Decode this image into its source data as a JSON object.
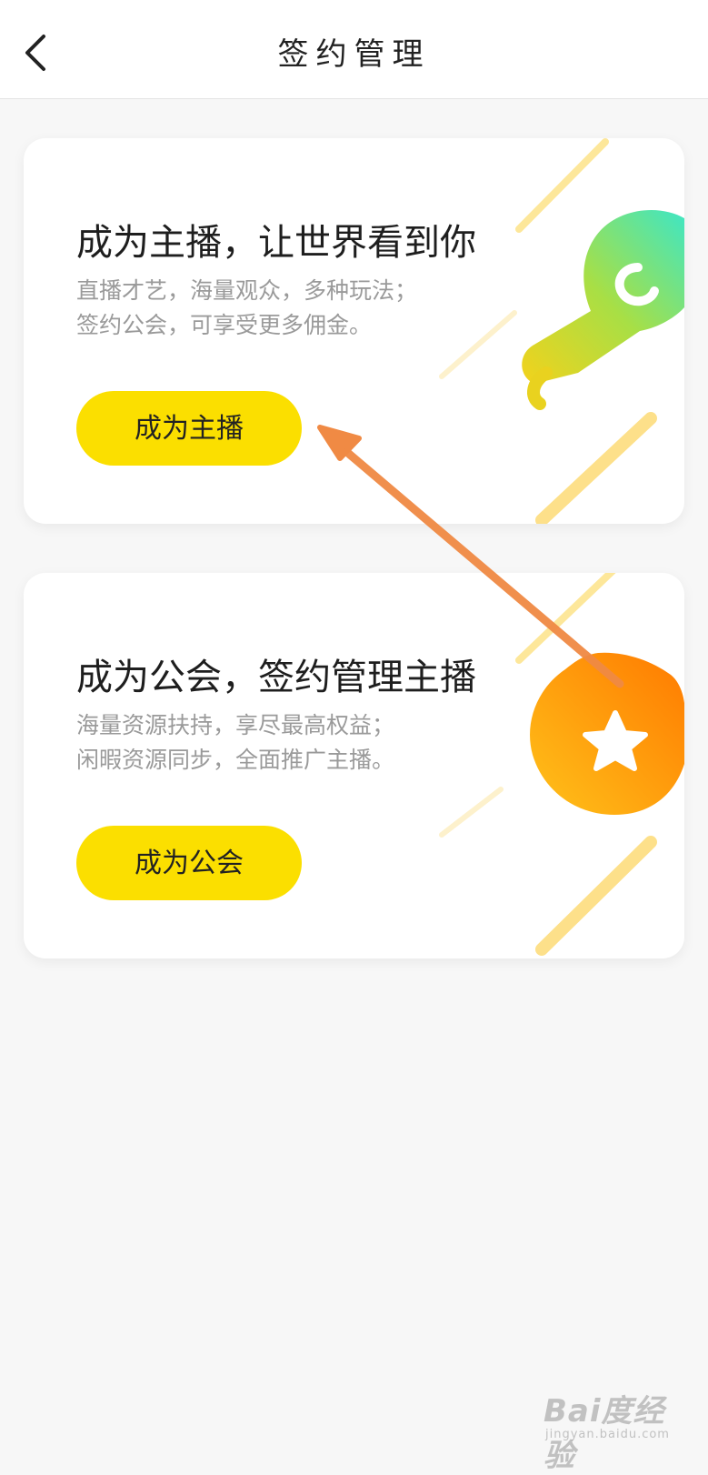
{
  "header": {
    "title": "签约管理"
  },
  "cards": [
    {
      "headline": "成为主播，让世界看到你",
      "desc_line1": "直播才艺，海量观众，多种玩法；",
      "desc_line2": "签约公会，可享受更多佣金。",
      "button_label": "成为主播",
      "icon": "microphone-icon"
    },
    {
      "headline": "成为公会，签约管理主播",
      "desc_line1": "海量资源扶持，享尽最高权益；",
      "desc_line2": "闲暇资源同步，全面推广主播。",
      "button_label": "成为公会",
      "icon": "star-badge-icon"
    }
  ],
  "watermark": {
    "logo": "Bai度经验",
    "url": "jingyan.baidu.com"
  },
  "colors": {
    "accent_yellow": "#fbdf00",
    "arrow_orange": "#f08a44",
    "text_secondary": "#9a9a9a",
    "page_bg": "#f7f7f7"
  }
}
